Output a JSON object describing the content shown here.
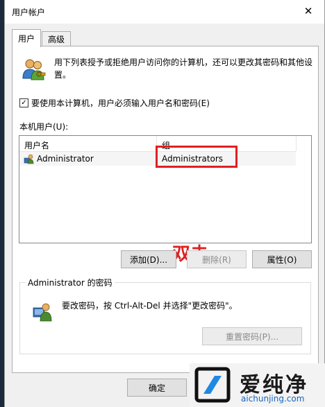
{
  "window": {
    "title": "用户帐户",
    "close_symbol": "✕"
  },
  "tabs": [
    {
      "label": "用户",
      "active": true
    },
    {
      "label": "高级",
      "active": false
    }
  ],
  "intro_text": "用下列表授予或拒绝用户访问你的计算机，还可以更改其密码和其他设置。",
  "checkbox": {
    "label": "要使用本计算机，用户必须输入用户名和密码(E)",
    "checked": true,
    "check_glyph": "✓"
  },
  "local_users_label": "本机用户(U):",
  "list": {
    "columns": [
      "用户名",
      "组"
    ],
    "rows": [
      {
        "name": "Administrator",
        "group": "Administrators"
      }
    ]
  },
  "annotation_text": "双击",
  "annotation_color": "#e02020",
  "buttons": {
    "add": "添加(D)...",
    "remove": "删除(R)",
    "properties": "属性(O)"
  },
  "password_group": {
    "title": "Administrator 的密码",
    "text": "要改密码，按 Ctrl-Alt-Del 并选择\"更改密码\"。",
    "reset_button": "重置密码(P)..."
  },
  "ok_button": "确定",
  "watermark": {
    "brand": "爱纯净",
    "url": "aichunjing.com"
  },
  "icons": {
    "users": "users-icon",
    "user_row": "user-icon",
    "password": "password-user-icon",
    "logo": "logo-icon"
  }
}
